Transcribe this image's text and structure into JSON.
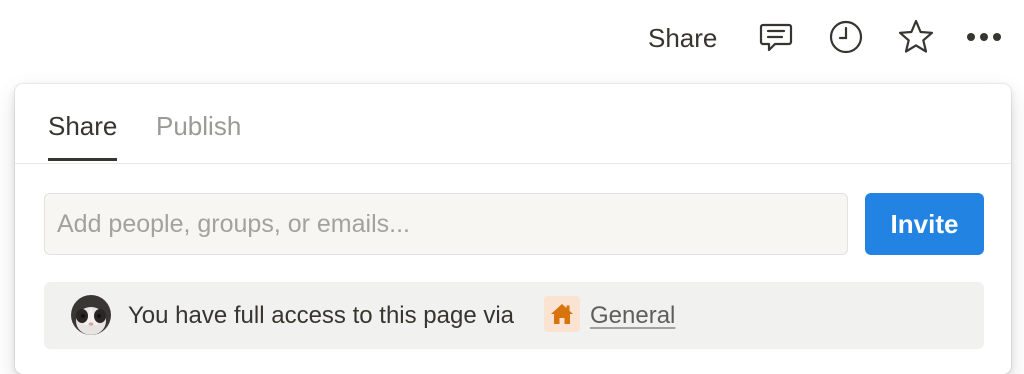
{
  "topbar": {
    "share_label": "Share",
    "icons": [
      "comment-icon",
      "history-clock-icon",
      "star-icon",
      "more-dots-icon"
    ]
  },
  "popover": {
    "tabs": [
      {
        "label": "Share",
        "active": true
      },
      {
        "label": "Publish",
        "active": false
      }
    ],
    "invite": {
      "placeholder": "Add people, groups, or emails...",
      "value": "",
      "button_label": "Invite"
    },
    "access": {
      "text": "You have full access to this page via",
      "workspace_icon": "home-icon",
      "workspace_label": "General"
    }
  },
  "colors": {
    "accent": "#2383e2",
    "text": "#37352f",
    "muted": "#9b9a97",
    "home_icon": "#d9730d",
    "home_badge_bg": "#fbe3d1"
  }
}
